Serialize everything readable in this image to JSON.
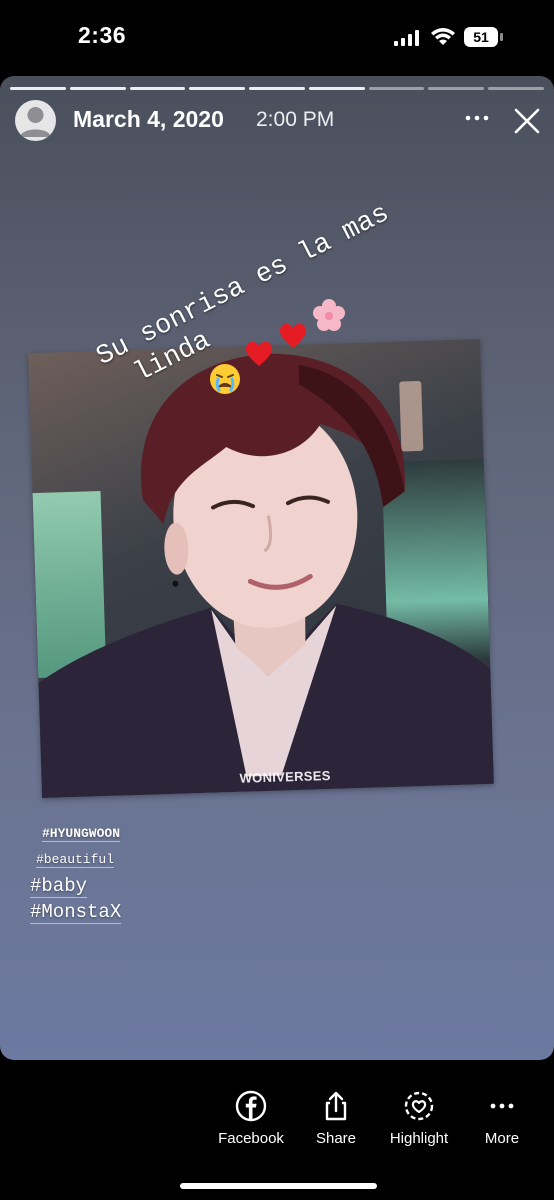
{
  "status_bar": {
    "time": "2:36",
    "battery": "51"
  },
  "story": {
    "progress": {
      "segments": 9,
      "completed": 6
    },
    "header": {
      "date": "March 4, 2020",
      "time": "2:00 PM"
    },
    "caption": {
      "line1": "Su sonrisa es la mas",
      "line2": "linda"
    },
    "emojis": [
      "crying-face-emoji",
      "red-heart-emoji",
      "red-heart-emoji",
      "cherry-blossom-emoji"
    ],
    "photo": {
      "watermark": "WONIVERSES"
    },
    "hashtags": [
      "#HYUNGWOON",
      "#beautiful",
      "#baby",
      "#MonstaX"
    ]
  },
  "bottom_actions": [
    {
      "label": "Facebook",
      "icon": "facebook-icon"
    },
    {
      "label": "Share",
      "icon": "share-icon"
    },
    {
      "label": "Highlight",
      "icon": "highlight-icon"
    },
    {
      "label": "More",
      "icon": "more-dots-icon"
    }
  ]
}
